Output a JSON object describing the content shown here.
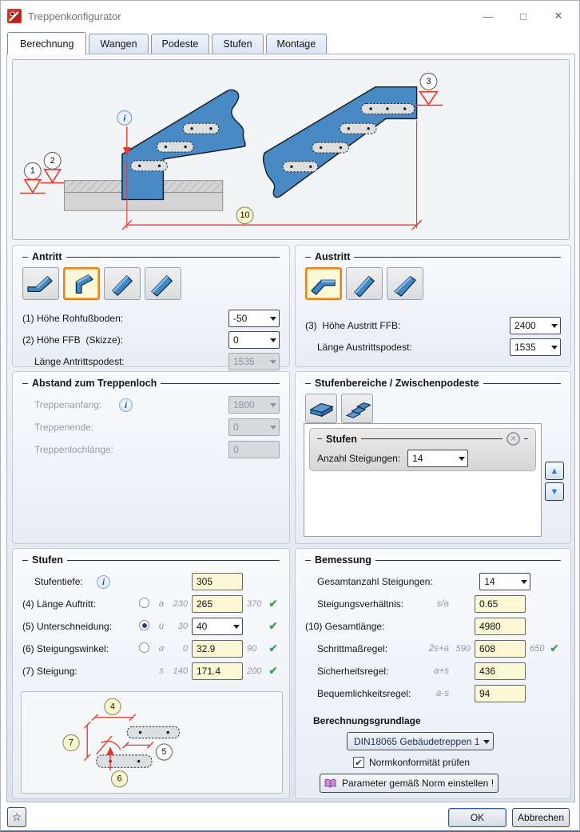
{
  "titlebar": {
    "title": "Treppenkonfigurator",
    "minimize": "—",
    "maximize": "□",
    "close": "✕"
  },
  "tabs": [
    {
      "label": "Berechnung"
    },
    {
      "label": "Wangen"
    },
    {
      "label": "Podeste"
    },
    {
      "label": "Stufen"
    },
    {
      "label": "Montage"
    }
  ],
  "diagram": {
    "m1": "1",
    "m2": "2",
    "m3": "3",
    "m10": "10",
    "info": "i"
  },
  "antritt": {
    "title": "Antritt",
    "rows": [
      {
        "label": "(1) Höhe Rohfußboden:",
        "value": "-50"
      },
      {
        "label": "(2) Höhe FFB  (Skizze):",
        "value": "0"
      },
      {
        "label": "Länge Antrittspodest:",
        "value": "1535"
      }
    ]
  },
  "austritt": {
    "title": "Austritt",
    "rows": [
      {
        "label": "(3)  Höhe Austritt FFB:",
        "value": "2400"
      },
      {
        "label": "Länge Austrittspodest:",
        "value": "1535"
      }
    ]
  },
  "treppenloch": {
    "title": "Abstand zum Treppenloch",
    "info": "i",
    "rows": [
      {
        "label": "Treppenanfang:",
        "value": "1800"
      },
      {
        "label": "Treppenende:",
        "value": "0"
      },
      {
        "label": "Treppenlochlänge:",
        "value": "0"
      }
    ]
  },
  "stufenbereiche": {
    "title": "Stufenbereiche / Zwischenpodeste",
    "card": {
      "title": "Stufen",
      "label": "Anzahl Steigungen:",
      "value": "14"
    }
  },
  "stufen": {
    "title": "Stufen",
    "info": "i",
    "rows": [
      {
        "label": "Stufentiefe:",
        "value": "305"
      },
      {
        "label": "(4) Länge Auftritt:",
        "sym": "a",
        "min": "230",
        "value": "265",
        "max": "370"
      },
      {
        "label": "(5) Unterschneidung:",
        "sym": "u",
        "min": "30",
        "value": "40"
      },
      {
        "label": "(6) Steigungswinkel:",
        "sym": "α",
        "min": "0",
        "value": "32.9",
        "max": "90"
      },
      {
        "label": "(7) Steigung:",
        "sym": "s",
        "min": "140",
        "value": "171.4",
        "max": "200"
      }
    ],
    "markers": {
      "m4": "4",
      "m5": "5",
      "m6": "6",
      "m7": "7"
    }
  },
  "bemessung": {
    "title": "Bemessung",
    "rows": [
      {
        "label": "Gesamtanzahl Steigungen:",
        "value": "14"
      },
      {
        "label": "Steigungsverhältnis:",
        "sym": "s/a",
        "value": "0.65"
      },
      {
        "label": "(10) Gesamtlänge:",
        "value": "4980"
      },
      {
        "label": "Schrittmaßregel:",
        "sym": "2s+a",
        "min": "590",
        "value": "608",
        "max": "650"
      },
      {
        "label": "Sicherheitsregel:",
        "sym": "a+s",
        "value": "436"
      },
      {
        "label": "Bequemlichkeitsregel:",
        "sym": "a-s",
        "value": "94"
      }
    ]
  },
  "grundlage": {
    "title": "Berechnungsgrundlage",
    "norm": "DIN18065 Gebäudetreppen 1",
    "checkbox": "Normkonformität prüfen",
    "button": "Parameter gemäß Norm einstellen !"
  },
  "footer": {
    "ok": "OK",
    "cancel": "Abbrechen"
  },
  "icons": {
    "check": "✔",
    "star": "☆",
    "close_small": "✕",
    "up": "▲",
    "down": "▼"
  },
  "colors": {
    "accent_orange": "#e8831f",
    "stair_blue": "#4a8ac4",
    "dim_red": "#e8362b",
    "field_yellow": "#fcf8d6",
    "check_green": "#3fa24a"
  }
}
